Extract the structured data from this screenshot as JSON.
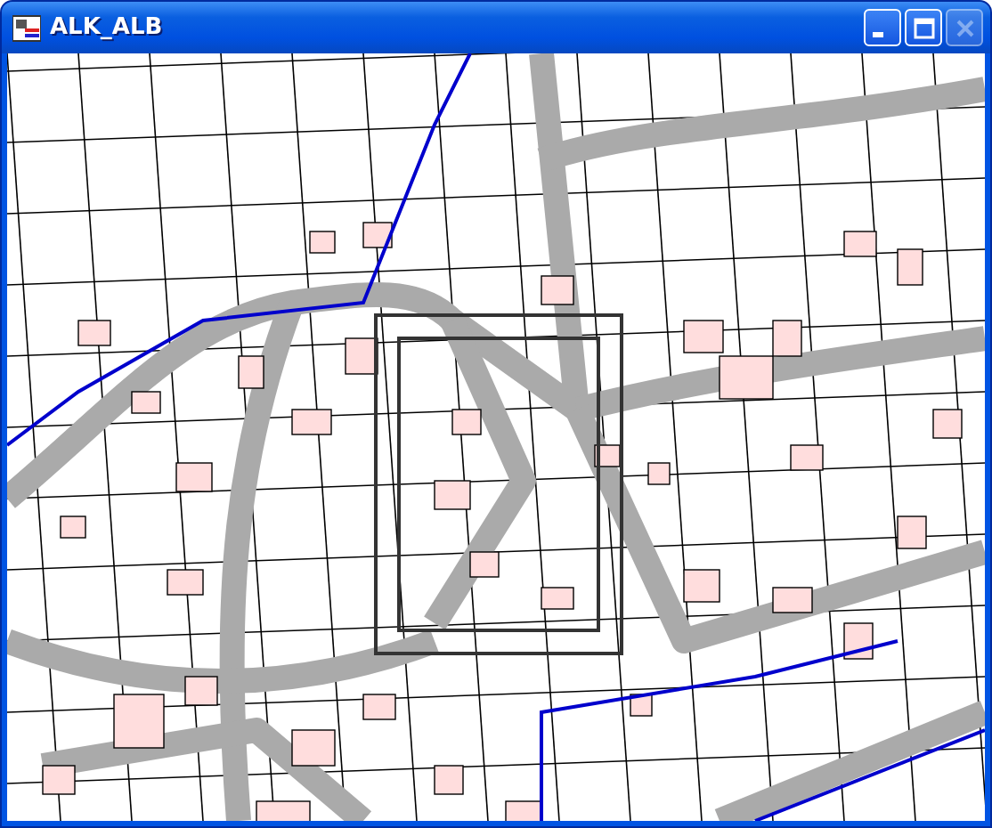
{
  "window": {
    "title": "ALK_ALB",
    "controls": [
      {
        "kind": "minimize",
        "disabled": false
      },
      {
        "kind": "maximize",
        "disabled": false
      },
      {
        "kind": "close",
        "disabled": true
      }
    ]
  }
}
